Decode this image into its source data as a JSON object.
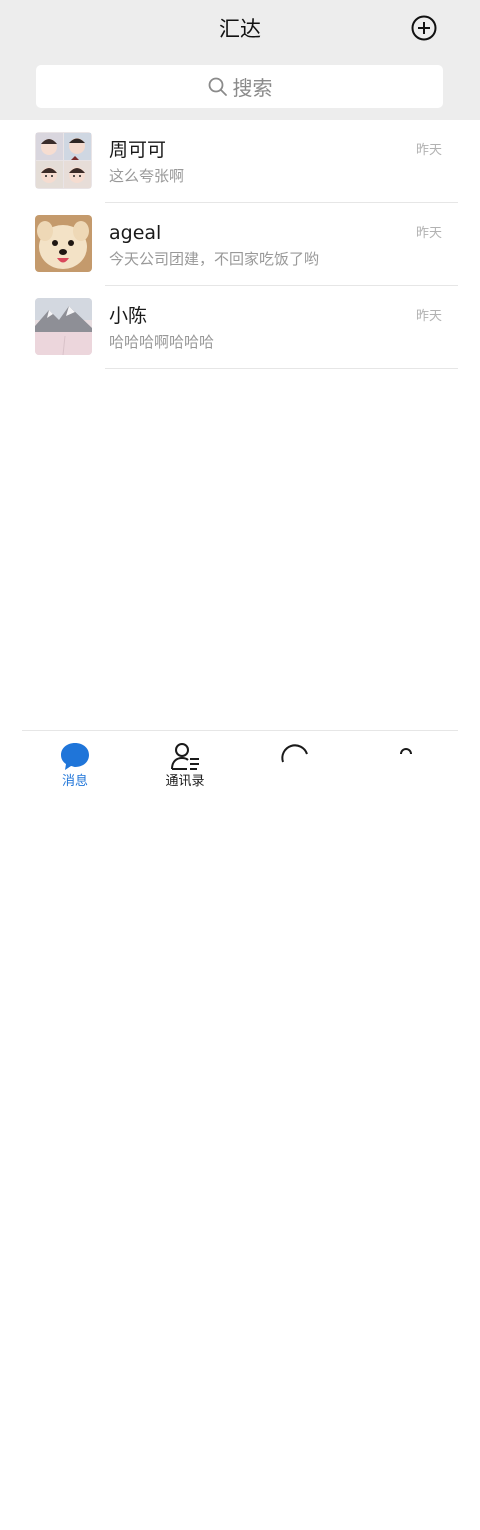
{
  "header": {
    "title": "汇达",
    "add_icon": "plus-circle-icon"
  },
  "search": {
    "placeholder": "搜索",
    "icon": "search-icon"
  },
  "conversations": [
    {
      "name": "周可可",
      "preview": "这么夸张啊",
      "time": "昨天",
      "avatar": "group-photo-collage"
    },
    {
      "name": "ageal",
      "preview": "今天公司团建，不回家吃饭了哟",
      "time": "昨天",
      "avatar": "dog-photo"
    },
    {
      "name": "小陈",
      "preview": "哈哈哈啊哈哈哈",
      "time": "昨天",
      "avatar": "snow-mountain-photo"
    }
  ],
  "tabs": [
    {
      "label": "消息",
      "icon": "chat-bubble-icon",
      "active": true
    },
    {
      "label": "通讯录",
      "icon": "contacts-icon",
      "active": false
    }
  ],
  "colors": {
    "header_bg": "#ededed",
    "accent": "#1f75d9",
    "subtext": "#999999"
  }
}
